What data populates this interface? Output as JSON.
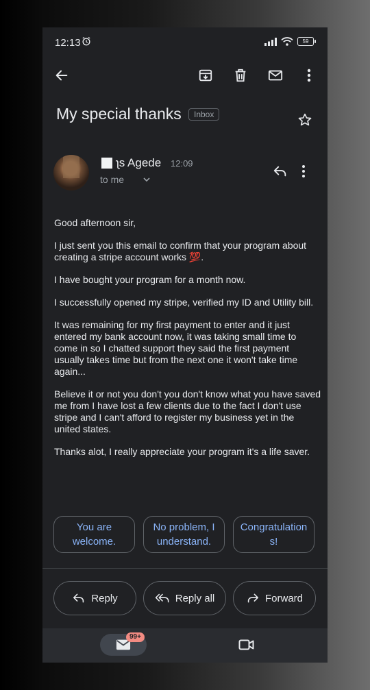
{
  "status_bar": {
    "time": "12:13",
    "battery": "59",
    "icons": [
      "alarm-icon",
      "signal-icon",
      "wifi-icon",
      "battery-icon"
    ]
  },
  "toolbar": {
    "icons": [
      "back-arrow-icon",
      "archive-icon",
      "delete-icon",
      "mark-unread-icon",
      "more-vert-icon"
    ]
  },
  "email": {
    "subject": "My special thanks",
    "label": "Inbox",
    "sender_name": "ʅs Agede",
    "time": "12:09",
    "recipient": "to me",
    "body": [
      "Good afternoon sir,",
      "I just sent you this email to confirm that your program about creating a stripe account works 💯.",
      "I have bought your program for a month now.",
      "I successfully opened my stripe, verified my ID and Utility bill.",
      "It was remaining for my first payment to enter and it just entered my bank account now, it was taking small time to come in so I chatted support they said the first payment usually takes time but from the next one it won't take time again...",
      "Believe it or not you don't you don't know what you have saved me from I have lost a few clients due to the fact I don't use stripe and I can't afford to register my business yet in the united states.",
      "Thanks alot, I really appreciate your program it's a life saver."
    ]
  },
  "smart_replies": [
    "You are welcome.",
    "No problem, I understand.",
    "Congratulations!"
  ],
  "actions": {
    "reply": "Reply",
    "reply_all": "Reply all",
    "forward": "Forward"
  },
  "bottom_nav": {
    "mail_badge": "99+",
    "icons": [
      "mail-icon",
      "video-icon"
    ]
  },
  "colors": {
    "background": "#202124",
    "text": "#e8eaed",
    "secondary_text": "#9aa0a6",
    "accent": "#8ab4f8",
    "badge": "#f28b82"
  }
}
